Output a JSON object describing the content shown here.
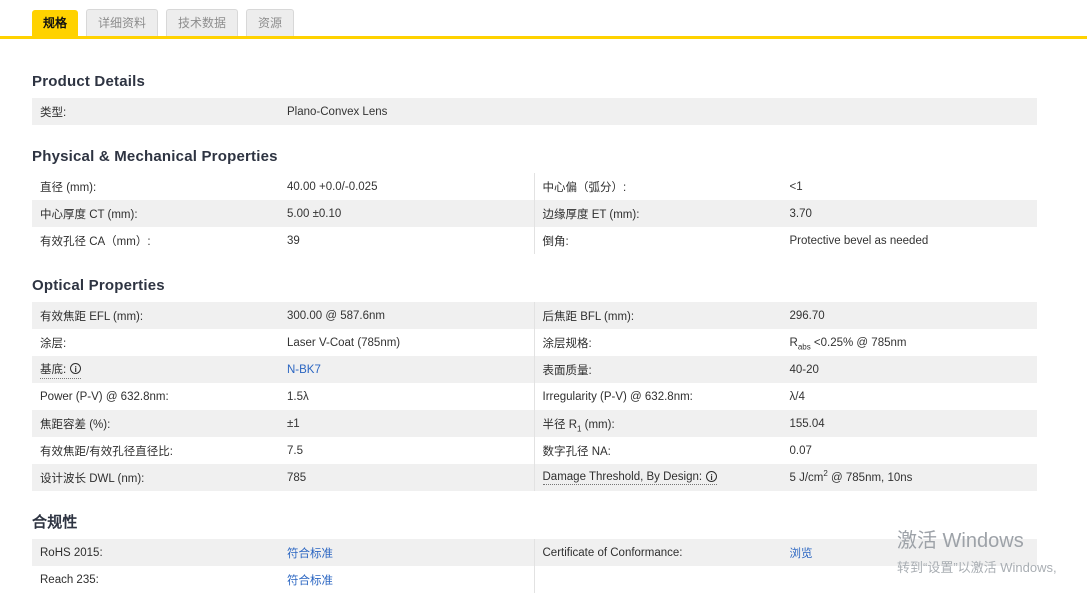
{
  "colors": {
    "accent_yellow": "#FFD200",
    "link_blue": "#2b66c2",
    "row_gray": "#f0f0f0"
  },
  "tabs": [
    {
      "label": "规格",
      "active": true
    },
    {
      "label": "详细资料",
      "active": false
    },
    {
      "label": "技术数据",
      "active": false
    },
    {
      "label": "资源",
      "active": false
    }
  ],
  "sections": [
    {
      "title": "Product Details",
      "rows": [
        {
          "left": {
            "label": "类型:",
            "value": "Plano-Convex Lens"
          }
        }
      ]
    },
    {
      "title": "Physical & Mechanical Properties",
      "rows": [
        {
          "left": {
            "label": "直径 (mm):",
            "value": "40.00 +0.0/-0.025"
          },
          "right": {
            "label": "中心偏（弧分）:",
            "value": "<1"
          }
        },
        {
          "left": {
            "label": "中心厚度 CT (mm):",
            "value": "5.00 ±0.10"
          },
          "right": {
            "label": "边缘厚度 ET (mm):",
            "value": "3.70"
          }
        },
        {
          "left": {
            "label": "有效孔径 CA（mm）:",
            "value": "39"
          },
          "right": {
            "label": "倒角:",
            "value": "Protective bevel as needed"
          }
        }
      ]
    },
    {
      "title": "Optical Properties",
      "rows": [
        {
          "left": {
            "label": "有效焦距 EFL (mm):",
            "value": "300.00 @ 587.6nm"
          },
          "right": {
            "label": "后焦距 BFL (mm):",
            "value": "296.70"
          }
        },
        {
          "left": {
            "label": "涂层:",
            "value": "Laser V-Coat (785nm)"
          },
          "right": {
            "label": "涂层规格:",
            "value_pre": "R",
            "value_sub": "abs",
            "value_post": " <0.25% @ 785nm"
          }
        },
        {
          "left": {
            "label": "基底:",
            "value_link": "N-BK7"
          },
          "right": {
            "label": "表面质量:",
            "value": "40-20"
          }
        },
        {
          "left": {
            "label": "Power (P-V) @ 632.8nm:",
            "value": "1.5λ"
          },
          "right": {
            "label": "Irregularity (P-V) @ 632.8nm:",
            "value": "λ/4"
          }
        },
        {
          "left": {
            "label": "焦距容差 (%):",
            "value": "±1"
          },
          "right": {
            "label_pre": "半径 R",
            "label_sub": "1",
            "label_post": " (mm):",
            "value": "155.04"
          }
        },
        {
          "left": {
            "label": "有效焦距/有效孔径直径比:",
            "value": "7.5"
          },
          "right": {
            "label": "数字孔径 NA:",
            "value": "0.07"
          }
        },
        {
          "left": {
            "label": "设计波长 DWL (nm):",
            "value": "785"
          },
          "right": {
            "label": "Damage Threshold, By Design:",
            "value_pre": "5 J/cm",
            "value_sup": "2",
            "value_post": " @ 785nm, 10ns"
          }
        }
      ]
    },
    {
      "title": "合规性",
      "rows": [
        {
          "left": {
            "label": "RoHS 2015:",
            "value_link": "符合标准"
          },
          "right": {
            "label": "Certificate of Conformance:",
            "value_link": "浏览"
          }
        },
        {
          "left": {
            "label": "Reach 235:",
            "value_link": "符合标准"
          },
          "right": {
            "label": "",
            "value": ""
          }
        }
      ]
    }
  ],
  "watermark": {
    "line1": "激活 Windows",
    "line2": "转到“设置”以激活 Windows,"
  }
}
